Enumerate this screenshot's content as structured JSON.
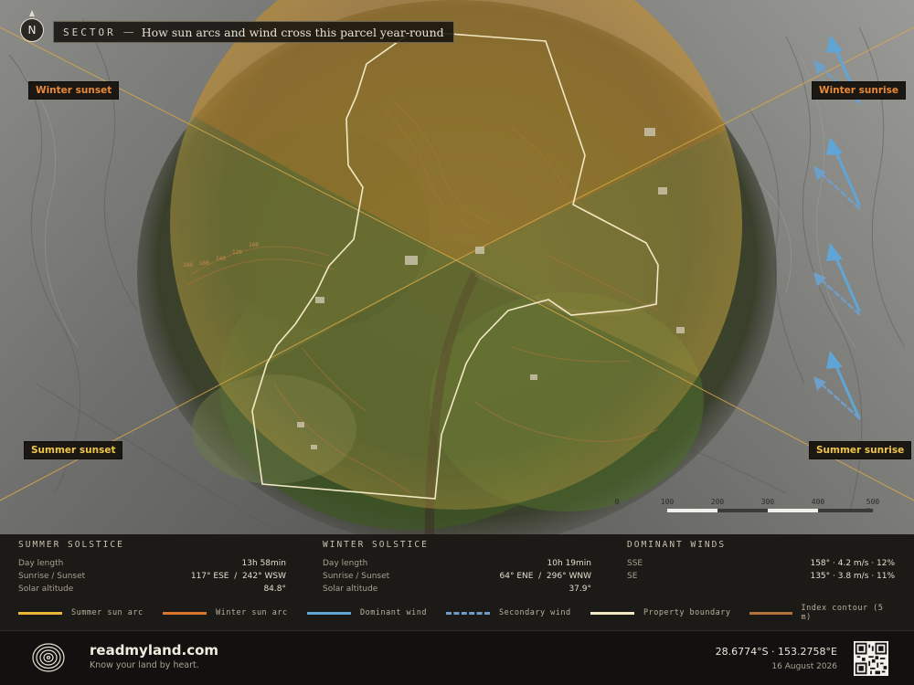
{
  "title": {
    "key": "SECTOR",
    "dash": "—",
    "text": "How sun arcs and wind cross this parcel year-round"
  },
  "north": "N",
  "sun_labels": {
    "winter_sunset": "Winter sunset",
    "winter_sunrise": "Winter sunrise",
    "summer_sunset": "Summer sunset",
    "summer_sunrise": "Summer sunrise"
  },
  "contour_labels": [
    "180",
    "160",
    "140",
    "120",
    "100"
  ],
  "scale": {
    "ticks": [
      "0",
      "100",
      "200",
      "300",
      "400",
      "500 m"
    ]
  },
  "summer": {
    "heading": "SUMMER SOLSTICE",
    "rows": [
      {
        "k": "Day length",
        "v": "13h 58min"
      },
      {
        "k": "Sunrise / Sunset",
        "v": "117° ESE  /  242° WSW"
      },
      {
        "k": "Solar altitude",
        "v": "84.8°"
      }
    ]
  },
  "winter": {
    "heading": "WINTER SOLSTICE",
    "rows": [
      {
        "k": "Day length",
        "v": "10h 19min"
      },
      {
        "k": "Sunrise / Sunset",
        "v": "64° ENE  /  296° WNW"
      },
      {
        "k": "Solar altitude",
        "v": "37.9°"
      }
    ]
  },
  "winds": {
    "heading": "DOMINANT WINDS",
    "rows": [
      {
        "k": "SSE",
        "v": "158° · 4.2 m/s · 12%"
      },
      {
        "k": "SE",
        "v": "135° · 3.8 m/s · 11%"
      }
    ]
  },
  "legend": [
    {
      "label": "Summer sun arc",
      "color": "#e8b83a",
      "style": "solid"
    },
    {
      "label": "Winter sun arc",
      "color": "#d9772e",
      "style": "solid"
    },
    {
      "label": "Dominant wind",
      "color": "#5fa6d6",
      "style": "solid"
    },
    {
      "label": "Secondary wind",
      "color": "#6f9fc8",
      "style": "dashed"
    },
    {
      "label": "Property boundary",
      "color": "#f2e8c4",
      "style": "solid"
    },
    {
      "label": "Index contour (5 m)",
      "color": "#b0743a",
      "style": "solid"
    }
  ],
  "footer": {
    "brand": "readmyland.com",
    "tagline": "Know your land by heart.",
    "coords": "28.6774°S · 153.2758°E",
    "date": "16 August 2026"
  },
  "colors": {
    "summer_arc": "#e8b83a",
    "winter_arc": "#d9772e",
    "wind": "#5fa6d6",
    "boundary": "#f2e8c4"
  }
}
